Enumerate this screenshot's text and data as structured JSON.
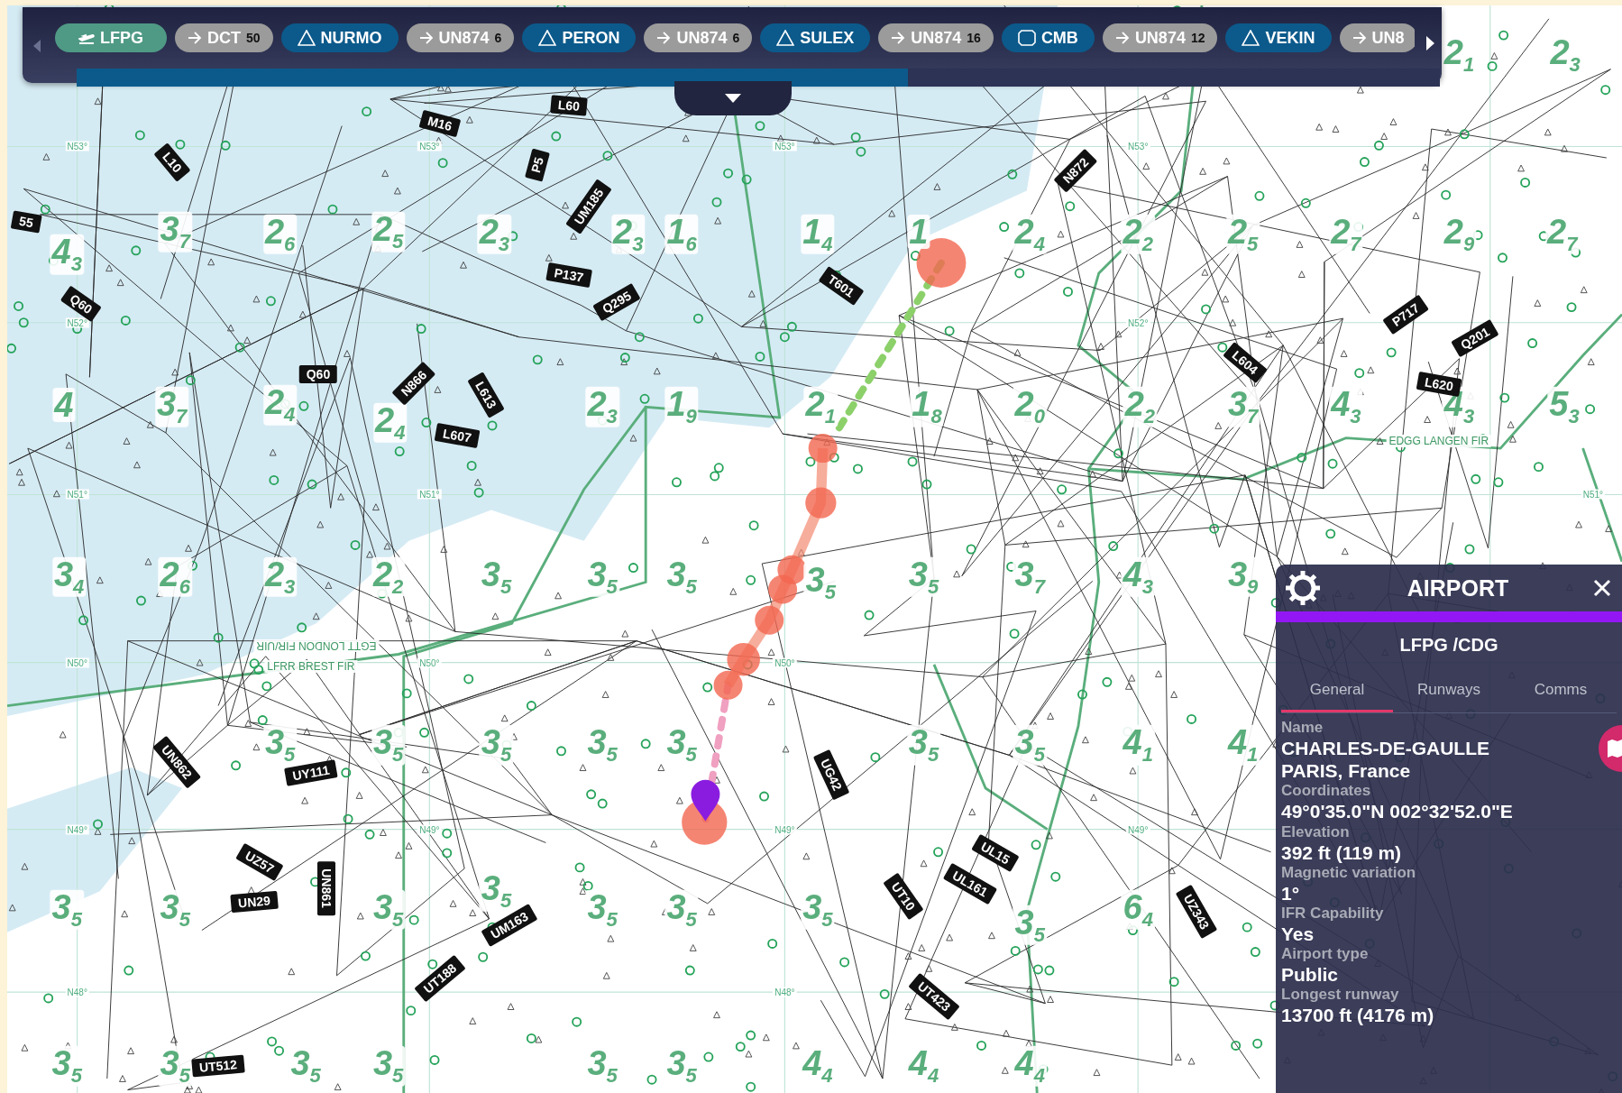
{
  "route_bar": {
    "chips": [
      {
        "kind": "airport",
        "label": "LFPG"
      },
      {
        "kind": "airway",
        "label": "DCT",
        "count": "50"
      },
      {
        "kind": "waypoint",
        "label": "NURMO"
      },
      {
        "kind": "airway",
        "label": "UN874",
        "count": "6"
      },
      {
        "kind": "waypoint",
        "label": "PERON"
      },
      {
        "kind": "airway",
        "label": "UN874",
        "count": "6"
      },
      {
        "kind": "waypoint",
        "label": "SULEX"
      },
      {
        "kind": "airway",
        "label": "UN874",
        "count": "16"
      },
      {
        "kind": "vor",
        "label": "CMB"
      },
      {
        "kind": "airway",
        "label": "UN874",
        "count": "12"
      },
      {
        "kind": "waypoint",
        "label": "VEKIN"
      },
      {
        "kind": "airway",
        "label": "UN8"
      }
    ],
    "progress": {
      "level": 0.61
    }
  },
  "map": {
    "airways": [
      "L60",
      "M16",
      "L10",
      "P5",
      "UM185",
      "55",
      "P137",
      "Q295",
      "Q60",
      "T601",
      "N872",
      "P717",
      "Q201",
      "L604",
      "L620",
      "Q60",
      "N866",
      "L613",
      "L607",
      "UN862",
      "UY111",
      "UG42",
      "UZ57",
      "UN861",
      "UN29",
      "UL15",
      "UL161",
      "UT10",
      "UZ343",
      "UM163",
      "UT188",
      "UT423",
      "UT512"
    ],
    "sectors": [
      "4$_{3}$",
      "3$_{7}$",
      "2$_{6}$",
      "2$_{5}$",
      "2$_{3}$",
      "2$_{3}$",
      "1$_{6}$",
      "1$_{4}$",
      "1",
      "2$_{4}$",
      "2$_{2}$",
      "2$_{5}$",
      "2$_{7}$",
      "2$_{9}$",
      "2$_{7}$",
      "2$_{1}$",
      "2$_{3}$",
      "4",
      "3$_{7}$",
      "2$_{4}$",
      "2$_{4}$",
      "2$_{3}$",
      "1$_{9}$",
      "2$_{1}$",
      "1$_{8}$",
      "2$_{0}$",
      "2$_{2}$",
      "3$_{7}$",
      "4$_{3}$",
      "4$_{3}$",
      "5$_{3}$",
      "3$_{4}$",
      "2$_{6}$",
      "2$_{3}$",
      "2$_{2}$",
      "3$_{5}$",
      "3$_{5}$",
      "3$_{5}$",
      "3$_{5}$",
      "3$_{5}$",
      "3$_{7}$",
      "4$_{3}$",
      "3$_{9}$",
      "3$_{5}$",
      "3$_{5}$",
      "3$_{5}$",
      "3$_{5}$",
      "3$_{5}$",
      "3$_{5}$",
      "3$_{5}$",
      "4$_{1}$",
      "4$_{1}$",
      "3$_{5}$",
      "3$_{5}$",
      "3$_{5}$",
      "3$_{5}$",
      "3$_{5}$",
      "3$_{5}$",
      "3$_{5}$",
      "3$_{5}$",
      "6$_{4}$",
      "3$_{5}$",
      "3$_{5}$",
      "3$_{5}$",
      "3$_{5}$",
      "3$_{5}$",
      "3$_{5}$",
      "4$_{4}$",
      "4$_{4}$",
      "4$_{4}$"
    ],
    "grid_labels": [
      "N53°",
      "N53°",
      "N53°",
      "N53°",
      "N52°",
      "N52°",
      "N51°",
      "N51°",
      "N51°",
      "N50°",
      "N50°",
      "N50°",
      "N49°",
      "N49°",
      "N49°",
      "N49°",
      "N48°",
      "N48°"
    ],
    "fir_labels": [
      "EGTT LONDON FIR/UIR",
      "LFRR BREST FIR",
      "EDGG LANGEN FIR"
    ]
  },
  "panel": {
    "title": "AIRPORT",
    "subtitle": "LFPG /CDG",
    "tabs": [
      {
        "label": "General",
        "selected": true
      },
      {
        "label": "Runways",
        "selected": false
      },
      {
        "label": "Comms",
        "selected": false
      }
    ],
    "fields": [
      {
        "label": "Name",
        "values": [
          "CHARLES-DE-GAULLE",
          "PARIS, France"
        ]
      },
      {
        "label": "Coordinates",
        "values": [
          "49°0'35.0\"N  002°32'52.0\"E"
        ]
      },
      {
        "label": "Elevation",
        "values": [
          "392 ft (119 m)"
        ]
      },
      {
        "label": "Magnetic variation",
        "values": [
          "1°"
        ]
      },
      {
        "label": "IFR Capability",
        "values": [
          "Yes"
        ]
      },
      {
        "label": "Airport type",
        "values": [
          "Public"
        ]
      },
      {
        "label": "Longest runway",
        "values": [
          "13700 ft (4176 m)"
        ]
      }
    ]
  }
}
